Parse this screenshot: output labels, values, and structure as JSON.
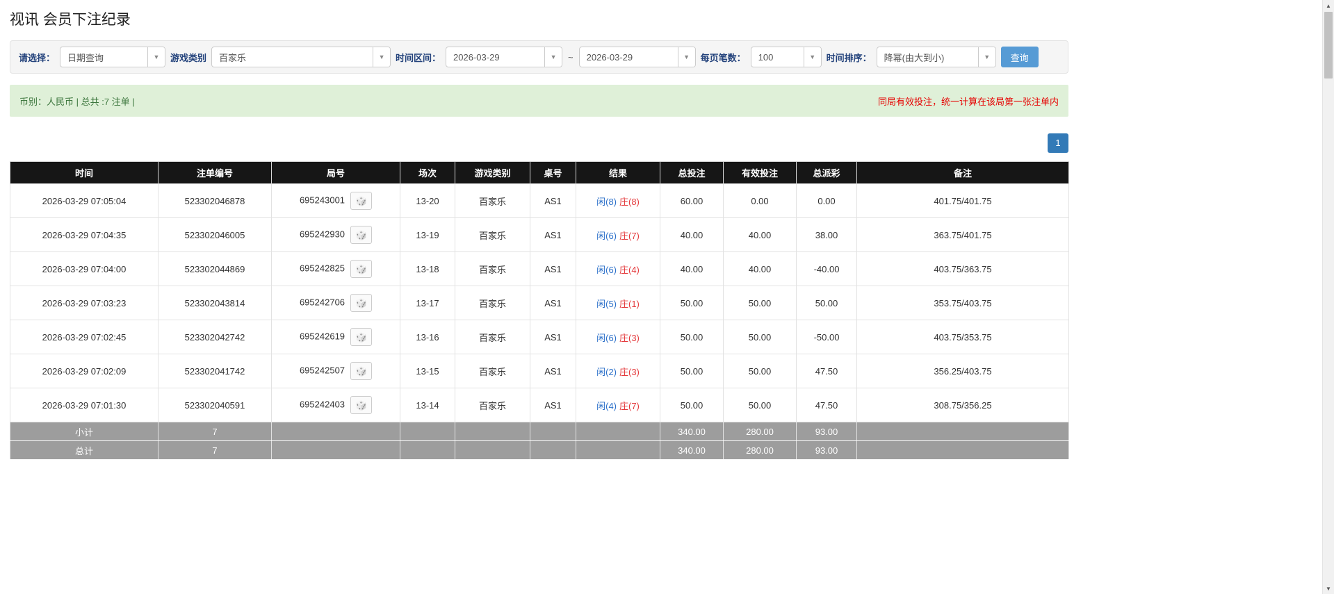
{
  "page": {
    "title": "视讯 会员下注纪录"
  },
  "colors": {
    "label_navy": "#24437c",
    "search_button": "#569bd5",
    "pagination": "#337ab7",
    "link_blue": "#2a6fc9",
    "red": "#e4393c",
    "warning_red": "#e60000",
    "success_bg": "#dff0d8",
    "success_text": "#3c763d",
    "header_bg": "#161616",
    "footer_bg": "#9d9d9d"
  },
  "filters": {
    "select_label": "请选择：",
    "select_value": "日期查询",
    "game_type_label": "游戏类别",
    "game_type_value": "百家乐",
    "time_range_label": "时间区间：",
    "time_from": "2026-03-29",
    "time_separator": "~",
    "time_to": "2026-03-29",
    "page_size_label": "每页笔数：",
    "page_size_value": "100",
    "sort_label": "时间排序：",
    "sort_value": "降幂(由大到小)",
    "search_button": "查询"
  },
  "summary": {
    "left": "币别：人民币 | 总共 :7 注单 |",
    "right": "同局有效投注，统一计算在该局第一张注单内"
  },
  "pagination": {
    "current": "1"
  },
  "table": {
    "headers": [
      "时间",
      "注单编号",
      "局号",
      "场次",
      "游戏类别",
      "桌号",
      "结果",
      "总投注",
      "有效投注",
      "总派彩",
      "备注"
    ],
    "dice_icon": "🎲",
    "rows": [
      {
        "time": "2026-03-29 07:05:04",
        "bet_id": "523302046878",
        "round": "695243001",
        "session": "13-20",
        "game": "百家乐",
        "table_no": "AS1",
        "player": "闲(8)",
        "banker": "庄(8)",
        "total_bet": "60.00",
        "valid_bet": "0.00",
        "payout": "0.00",
        "note": "401.75/401.75"
      },
      {
        "time": "2026-03-29 07:04:35",
        "bet_id": "523302046005",
        "round": "695242930",
        "session": "13-19",
        "game": "百家乐",
        "table_no": "AS1",
        "player": "闲(6)",
        "banker": "庄(7)",
        "total_bet": "40.00",
        "valid_bet": "40.00",
        "payout": "38.00",
        "note": "363.75/401.75"
      },
      {
        "time": "2026-03-29 07:04:00",
        "bet_id": "523302044869",
        "round": "695242825",
        "session": "13-18",
        "game": "百家乐",
        "table_no": "AS1",
        "player": "闲(6)",
        "banker": "庄(4)",
        "total_bet": "40.00",
        "valid_bet": "40.00",
        "payout": "-40.00",
        "note": "403.75/363.75"
      },
      {
        "time": "2026-03-29 07:03:23",
        "bet_id": "523302043814",
        "round": "695242706",
        "session": "13-17",
        "game": "百家乐",
        "table_no": "AS1",
        "player": "闲(5)",
        "banker": "庄(1)",
        "total_bet": "50.00",
        "valid_bet": "50.00",
        "payout": "50.00",
        "note": "353.75/403.75"
      },
      {
        "time": "2026-03-29 07:02:45",
        "bet_id": "523302042742",
        "round": "695242619",
        "session": "13-16",
        "game": "百家乐",
        "table_no": "AS1",
        "player": "闲(6)",
        "banker": "庄(3)",
        "total_bet": "50.00",
        "valid_bet": "50.00",
        "payout": "-50.00",
        "note": "403.75/353.75"
      },
      {
        "time": "2026-03-29 07:02:09",
        "bet_id": "523302041742",
        "round": "695242507",
        "session": "13-15",
        "game": "百家乐",
        "table_no": "AS1",
        "player": "闲(2)",
        "banker": "庄(3)",
        "total_bet": "50.00",
        "valid_bet": "50.00",
        "payout": "47.50",
        "note": "356.25/403.75"
      },
      {
        "time": "2026-03-29 07:01:30",
        "bet_id": "523302040591",
        "round": "695242403",
        "session": "13-14",
        "game": "百家乐",
        "table_no": "AS1",
        "player": "闲(4)",
        "banker": "庄(7)",
        "total_bet": "50.00",
        "valid_bet": "50.00",
        "payout": "47.50",
        "note": "308.75/356.25"
      }
    ],
    "subtotal": {
      "label": "小计",
      "count": "7",
      "total_bet": "340.00",
      "valid_bet": "280.00",
      "payout": "93.00"
    },
    "total": {
      "label": "总计",
      "count": "7",
      "total_bet": "340.00",
      "valid_bet": "280.00",
      "payout": "93.00"
    }
  }
}
